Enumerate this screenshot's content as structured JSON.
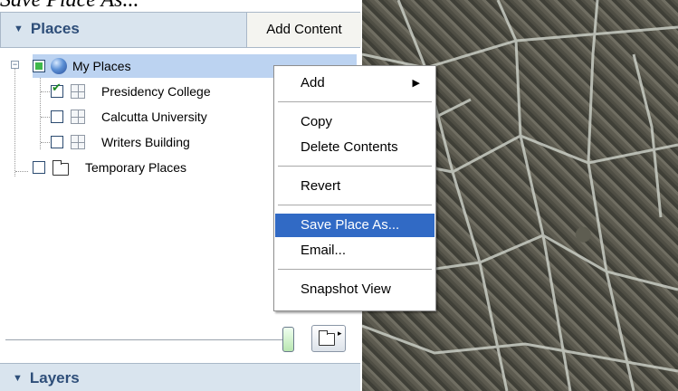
{
  "caption": "Save Place As...",
  "panel": {
    "title": "Places",
    "add_content": "Add Content",
    "layers_title": "Layers"
  },
  "tree": {
    "root": {
      "label": "My Places",
      "expander": "−"
    },
    "items": [
      {
        "label": "Presidency College",
        "checked": true
      },
      {
        "label": "Calcutta University",
        "checked": false
      },
      {
        "label": "Writers Building",
        "checked": false
      }
    ],
    "temporary": {
      "label": "Temporary Places"
    }
  },
  "context_menu": {
    "items": [
      {
        "label": "Add",
        "submenu": "▶"
      },
      {
        "label": "Copy"
      },
      {
        "label": "Delete Contents"
      },
      {
        "label": "Revert"
      },
      {
        "label": "Save Place As...",
        "highlighted": true
      },
      {
        "label": "Email..."
      },
      {
        "label": "Snapshot View"
      }
    ]
  },
  "icons": {
    "collapse": "triangle-down-icon",
    "globe": "my-places-globe-icon",
    "placemark": "placemark-icon",
    "folder": "folder-icon",
    "folder_button_arrow": "▸"
  },
  "colors": {
    "header_bg": "#d9e4ee",
    "header_text": "#2e4e79",
    "selection": "#bcd3f1",
    "menu_highlight": "#316ac5"
  }
}
